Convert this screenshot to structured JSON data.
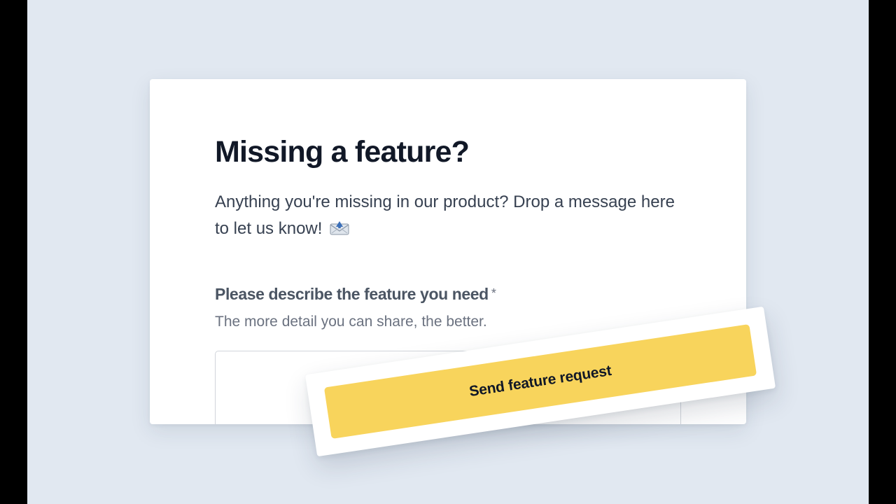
{
  "form": {
    "title": "Missing a feature?",
    "description": "Anything you're missing in our product? Drop a message here to let us know!",
    "description_icon": "envelope-with-arrow-icon",
    "field": {
      "label": "Please describe the feature you need",
      "required_mark": "*",
      "help": "The more detail you can share, the better.",
      "value": ""
    },
    "submit_label": "Send feature request"
  },
  "colors": {
    "background": "#e1e8f1",
    "card": "#ffffff",
    "button": "#f8d45c",
    "title_text": "#111827"
  }
}
